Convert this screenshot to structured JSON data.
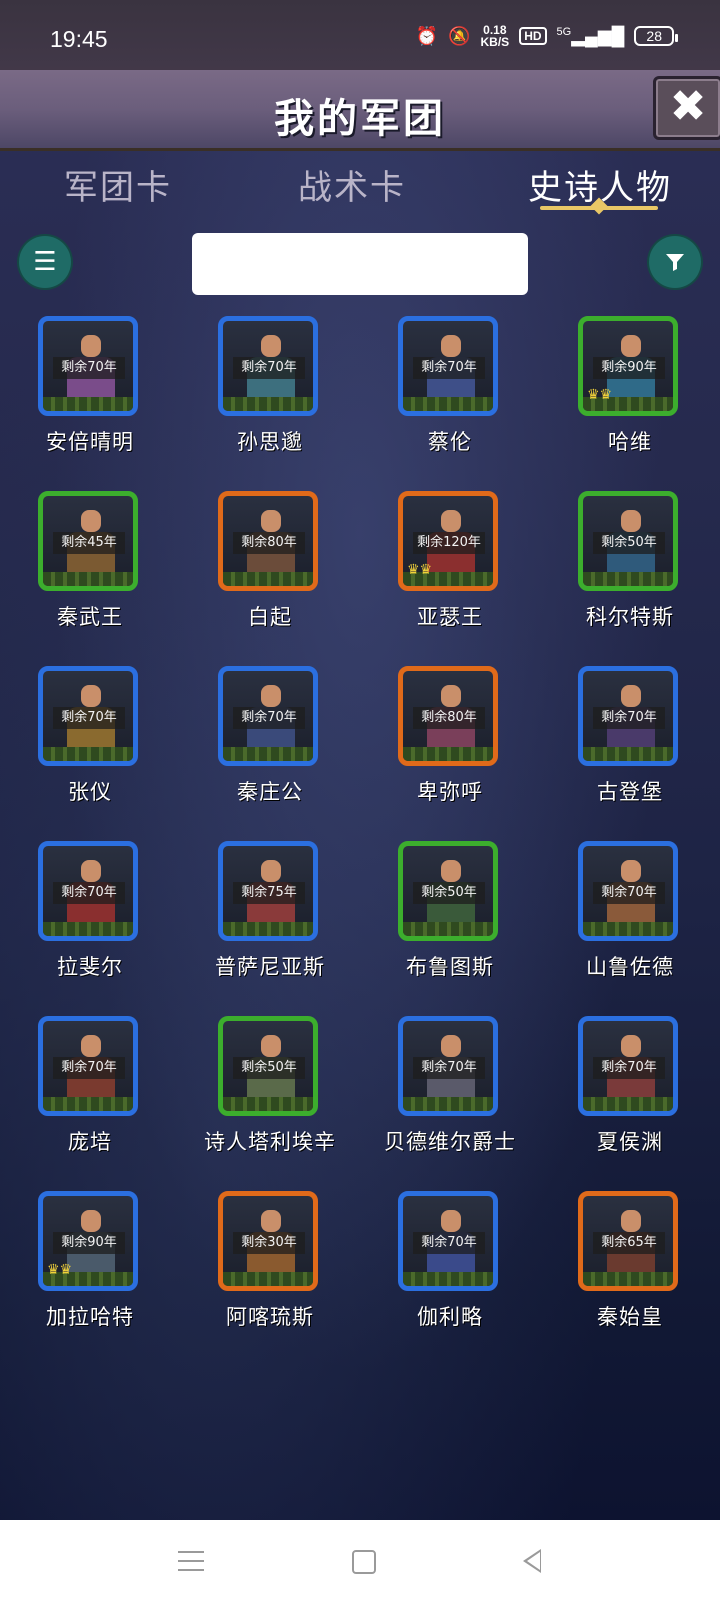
{
  "status": {
    "time": "19:45",
    "netspeed_value": "0.18",
    "netspeed_unit": "KB/S",
    "hd": "HD",
    "signal": "5G",
    "battery": "28"
  },
  "header": {
    "title": "我的军团",
    "close_label": "✖"
  },
  "tabs": [
    {
      "label": "军团卡",
      "active": false
    },
    {
      "label": "战术卡",
      "active": false
    },
    {
      "label": "史诗人物",
      "active": true
    }
  ],
  "search": {
    "value": "",
    "placeholder": ""
  },
  "heroes": [
    {
      "name": "安倍晴明",
      "remaining": "剩余70年",
      "rarity": "blue",
      "crown": false,
      "color": "#7a4c8a"
    },
    {
      "name": "孙思邈",
      "remaining": "剩余70年",
      "rarity": "blue",
      "crown": false,
      "color": "#3d6f7e"
    },
    {
      "name": "蔡伦",
      "remaining": "剩余70年",
      "rarity": "blue",
      "crown": false,
      "color": "#3e4f88"
    },
    {
      "name": "哈维",
      "remaining": "剩余90年",
      "rarity": "green",
      "crown": true,
      "color": "#2f6a88"
    },
    {
      "name": "秦武王",
      "remaining": "剩余45年",
      "rarity": "green",
      "crown": false,
      "color": "#7b5a32"
    },
    {
      "name": "白起",
      "remaining": "剩余80年",
      "rarity": "orange",
      "crown": false,
      "color": "#6b4c3a"
    },
    {
      "name": "亚瑟王",
      "remaining": "剩余120年",
      "rarity": "orange",
      "crown": true,
      "color": "#8b2f2f"
    },
    {
      "name": "科尔特斯",
      "remaining": "剩余50年",
      "rarity": "green",
      "crown": false,
      "color": "#2f5a7b"
    },
    {
      "name": "张仪",
      "remaining": "剩余70年",
      "rarity": "blue",
      "crown": false,
      "color": "#8a6a2f"
    },
    {
      "name": "秦庄公",
      "remaining": "剩余70年",
      "rarity": "blue",
      "crown": false,
      "color": "#3a4a7a"
    },
    {
      "name": "卑弥呼",
      "remaining": "剩余80年",
      "rarity": "orange",
      "crown": false,
      "color": "#7a3f5a"
    },
    {
      "name": "古登堡",
      "remaining": "剩余70年",
      "rarity": "blue",
      "crown": false,
      "color": "#4a3a6a"
    },
    {
      "name": "拉斐尔",
      "remaining": "剩余70年",
      "rarity": "blue",
      "crown": false,
      "color": "#8a2f2f"
    },
    {
      "name": "普萨尼亚斯",
      "remaining": "剩余75年",
      "rarity": "blue",
      "crown": false,
      "color": "#8a3a3a"
    },
    {
      "name": "布鲁图斯",
      "remaining": "剩余50年",
      "rarity": "green",
      "crown": false,
      "color": "#3a5a3a"
    },
    {
      "name": "山鲁佐德",
      "remaining": "剩余70年",
      "rarity": "blue",
      "crown": false,
      "color": "#8a5a3a"
    },
    {
      "name": "庞培",
      "remaining": "剩余70年",
      "rarity": "blue",
      "crown": false,
      "color": "#7a3a2f"
    },
    {
      "name": "诗人塔利埃辛",
      "remaining": "剩余50年",
      "rarity": "green",
      "crown": false,
      "color": "#5a6a4a"
    },
    {
      "name": "贝德维尔爵士",
      "remaining": "剩余70年",
      "rarity": "blue",
      "crown": false,
      "color": "#5a5a6a"
    },
    {
      "name": "夏侯渊",
      "remaining": "剩余70年",
      "rarity": "blue",
      "crown": false,
      "color": "#7a3a3a"
    },
    {
      "name": "加拉哈特",
      "remaining": "剩余90年",
      "rarity": "blue",
      "crown": true,
      "color": "#4a5a6a"
    },
    {
      "name": "阿喀琉斯",
      "remaining": "剩余30年",
      "rarity": "orange",
      "crown": false,
      "color": "#8a5a2f"
    },
    {
      "name": "伽利略",
      "remaining": "剩余70年",
      "rarity": "blue",
      "crown": false,
      "color": "#3a4a8a"
    },
    {
      "name": "秦始皇",
      "remaining": "剩余65年",
      "rarity": "orange",
      "crown": false,
      "color": "#6a3a2f"
    }
  ]
}
